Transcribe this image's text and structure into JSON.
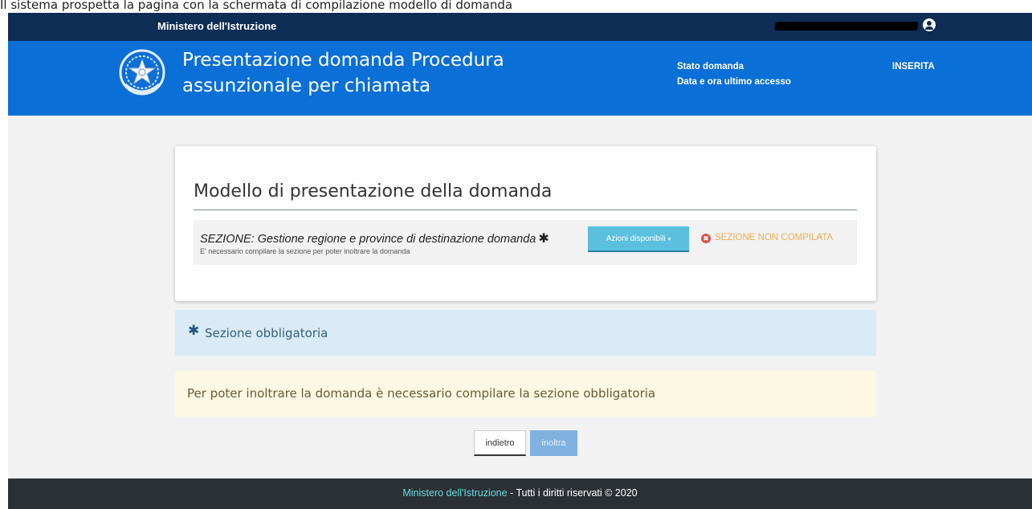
{
  "browser": {
    "caption": "Il sistema prospetta la pagina con la schermata di compilazione modello di domanda"
  },
  "topbar": {
    "ministry": "Ministero dell'Istruzione",
    "user_icon": "user-circle-icon"
  },
  "header": {
    "emblem": "italian-republic-emblem",
    "title": "Presentazione domanda Procedura assunzionale per chiamata",
    "state_label": "Stato domanda",
    "access_label": "Data e ora ultimo accesso",
    "state_value": "INSERITA"
  },
  "card": {
    "title": "Modello di presentazione della domanda",
    "section": {
      "title": "SEZIONE: Gestione regione e province di destinazione domanda",
      "required_mark": "✱",
      "note": "E' necessario compilare la sezione per poter inoltrare la domanda",
      "actions_label": "Azioni disponibili",
      "actions_caret": "▾",
      "status_icon": "times-circle-icon",
      "status_icon_glyph": "✖",
      "status_label": "SEZIONE NON COMPILATA"
    }
  },
  "info": {
    "asterisk": "✱",
    "label": "Sezione obbligatoria"
  },
  "warning": {
    "text": "Per poter inoltrare la domanda è necessario compilare la sezione obbligatoria"
  },
  "buttons": {
    "back": "indietro",
    "send": "inoltra"
  },
  "footer": {
    "link": "Ministero dell'Istruzione",
    "rest": " - Tutti i diritti riservati © 2020"
  },
  "colors": {
    "topbar": "#0d2d55",
    "header": "#0a6fd6",
    "info_button": "#5bc0de",
    "status_warning": "#f0ad4e",
    "status_danger": "#d9534f",
    "footer": "#2b3035",
    "footer_link": "#65dcdf"
  }
}
